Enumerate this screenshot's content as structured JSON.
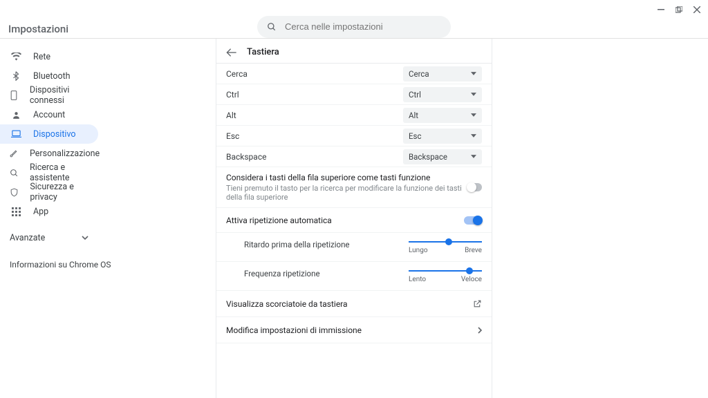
{
  "window": {
    "title": "Impostazioni"
  },
  "search": {
    "placeholder": "Cerca nelle impostazioni"
  },
  "sidebar": {
    "items": [
      {
        "label": "Rete"
      },
      {
        "label": "Bluetooth"
      },
      {
        "label": "Dispositivi connessi"
      },
      {
        "label": "Account"
      },
      {
        "label": "Dispositivo"
      },
      {
        "label": "Personalizzazione"
      },
      {
        "label": "Ricerca e assistente"
      },
      {
        "label": "Sicurezza e privacy"
      },
      {
        "label": "App"
      }
    ],
    "advanced": "Avanzate",
    "about": "Informazioni su Chrome OS"
  },
  "page": {
    "title": "Tastiera",
    "keys": [
      {
        "label": "Cerca",
        "value": "Cerca"
      },
      {
        "label": "Ctrl",
        "value": "Ctrl"
      },
      {
        "label": "Alt",
        "value": "Alt"
      },
      {
        "label": "Esc",
        "value": "Esc"
      },
      {
        "label": "Backspace",
        "value": "Backspace"
      }
    ],
    "topRow": {
      "title": "Considera i tasti della fila superiore come tasti funzione",
      "sub": "Tieni premuto il tasto per la ricerca per modificare la funzione dei tasti della fila superiore",
      "enabled": false
    },
    "autoRepeat": {
      "title": "Attiva ripetizione automatica",
      "enabled": true,
      "delay": {
        "label": "Ritardo prima della ripetizione",
        "min": "Lungo",
        "max": "Breve",
        "pct": 50
      },
      "rate": {
        "label": "Frequenza ripetizione",
        "min": "Lento",
        "max": "Veloce",
        "pct": 78
      }
    },
    "shortcuts": "Visualizza scorciatoie da tastiera",
    "input": "Modifica impostazioni di immissione"
  }
}
